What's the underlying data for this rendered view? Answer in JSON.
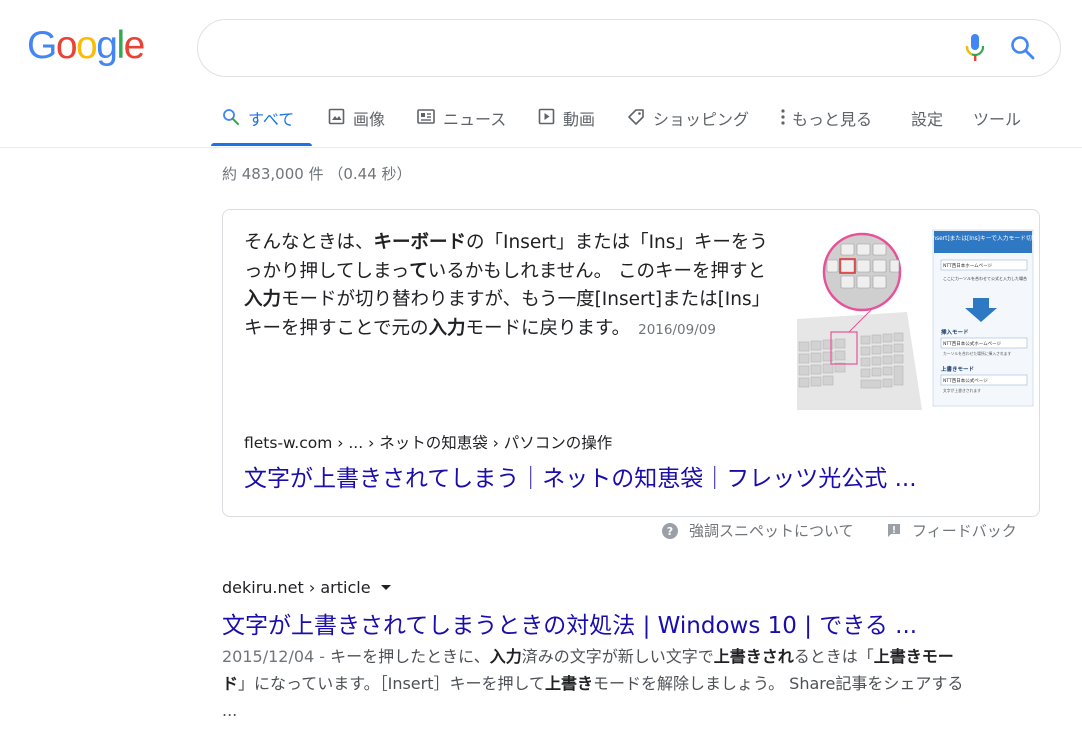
{
  "logo": {
    "letters": [
      "G",
      "o",
      "o",
      "g",
      "l",
      "e"
    ],
    "colors": [
      "#4285f4",
      "#ea4335",
      "#fbbc05",
      "#4285f4",
      "#34a853",
      "#ea4335"
    ]
  },
  "search": {
    "value": ""
  },
  "tabs": [
    {
      "label": "すべて",
      "icon": "search-icon"
    },
    {
      "label": "画像",
      "icon": "image-icon"
    },
    {
      "label": "ニュース",
      "icon": "news-icon"
    },
    {
      "label": "動画",
      "icon": "video-icon"
    },
    {
      "label": "ショッピング",
      "icon": "tag-icon"
    },
    {
      "label": "もっと見る",
      "icon": "more-vert-icon"
    },
    {
      "label": "設定"
    },
    {
      "label": "ツール"
    }
  ],
  "result_stats": "約 483,000 件 （0.44 秒）",
  "featured_snippet": {
    "text_parts": [
      {
        "t": "そんなときは、",
        "b": false
      },
      {
        "t": "キーボード",
        "b": true
      },
      {
        "t": "の「Insert」または「Ins」キーをうっかり押してしまっ",
        "b": false
      },
      {
        "t": "て",
        "b": true
      },
      {
        "t": "いるかもしれません。 このキーを押すと",
        "b": false
      },
      {
        "t": "入力",
        "b": true
      },
      {
        "t": "モードが切り替わりますが、もう一度[Insert]または[Ins」キーを押すことで元の",
        "b": false
      },
      {
        "t": "入力",
        "b": true
      },
      {
        "t": "モードに戻ります。",
        "b": false
      }
    ],
    "date": "2016/09/09",
    "cite": "flets-w.com › ... › ネットの知恵袋 › パソコンの操作",
    "title": "文字が上書きされてしまう｜ネットの知恵袋｜フレッツ光公式 ...",
    "image_caption": "[Insert]または[Ins]キーで入力モード切替",
    "image_labels": [
      "NTT西日本ホームページ",
      "ここにカーソルを合わせて公式と入力した場合",
      "挿入モード",
      "NTT西日本公式ホームページ",
      "カーソルを合わせた場所に挿入されます",
      "上書きモード",
      "NTT西日本公式ページ",
      "文字が上書きされます"
    ],
    "about_label": "強調スニペットについて",
    "feedback_label": "フィードバック"
  },
  "result2": {
    "cite": "dekiru.net › article",
    "title": "文字が上書きされてしまうときの対処法 | Windows 10 | できる ...",
    "date": "2015/12/04",
    "snippet_parts": [
      {
        "t": "キーを押したときに、",
        "b": false
      },
      {
        "t": "入力",
        "b": true
      },
      {
        "t": "済みの文字が新しい文字で",
        "b": false
      },
      {
        "t": "上書きされ",
        "b": true
      },
      {
        "t": "るときは「",
        "b": false
      },
      {
        "t": "上書きモード",
        "b": true
      },
      {
        "t": "」になっています。［Insert］キーを押して",
        "b": false
      },
      {
        "t": "上書き",
        "b": true
      },
      {
        "t": "モードを解除しましょう。 Share記事をシェアする ...",
        "b": false
      }
    ]
  }
}
